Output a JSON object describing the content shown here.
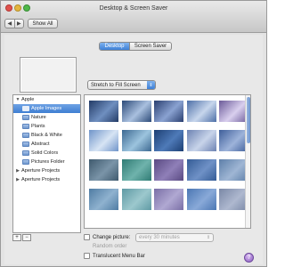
{
  "window": {
    "title": "Desktop & Screen Saver",
    "nav_back": "◀",
    "nav_forward": "▶",
    "show_all_label": "Show All"
  },
  "tabs": [
    {
      "label": "Desktop",
      "selected": true
    },
    {
      "label": "Screen Saver",
      "selected": false
    }
  ],
  "fit_select": {
    "value": "Stretch to Fill Screen",
    "chevron": "⇕"
  },
  "source_list": {
    "groups": [
      {
        "label": "Apple",
        "disclosure": "▼"
      },
      {
        "label": "Aperture Projects",
        "disclosure": "▶"
      },
      {
        "label": "Aperture Projects",
        "disclosure": "▶"
      }
    ],
    "children": [
      {
        "label": "Apple Images",
        "selected": true
      },
      {
        "label": "Nature"
      },
      {
        "label": "Plants"
      },
      {
        "label": "Black & White"
      },
      {
        "label": "Abstract"
      },
      {
        "label": "Solid Colors"
      },
      {
        "label": "Pictures Folder"
      }
    ]
  },
  "thumbnails": [
    {
      "color_a": "#233b66",
      "color_b": "#6f8fc0"
    },
    {
      "color_a": "#2c4a78",
      "color_b": "#a9c0df"
    },
    {
      "color_a": "#2a3f70",
      "color_b": "#8aa2d1"
    },
    {
      "color_a": "#4d6fa7",
      "color_b": "#c7d6ec"
    },
    {
      "color_a": "#6b5a98",
      "color_b": "#d9cfee"
    },
    {
      "color_a": "#6f94c9",
      "color_b": "#d7e4f4"
    },
    {
      "color_a": "#3c6891",
      "color_b": "#9cc4de"
    },
    {
      "color_a": "#1d3f73",
      "color_b": "#4e7ab8"
    },
    {
      "color_a": "#6c82b2",
      "color_b": "#c8d4ea"
    },
    {
      "color_a": "#3e5e9a",
      "color_b": "#9db3da"
    },
    {
      "color_a": "#3f5a6e",
      "color_b": "#7a94a8"
    },
    {
      "color_a": "#2f7b74",
      "color_b": "#6fb3ac"
    },
    {
      "color_a": "#5a4a82",
      "color_b": "#8f7fb8"
    },
    {
      "color_a": "#345c96",
      "color_b": "#6f91c6"
    },
    {
      "color_a": "#5d7fa9",
      "color_b": "#9fb6d4"
    },
    {
      "color_a": "#4f7ca3",
      "color_b": "#8fb2cf"
    },
    {
      "color_a": "#5f9aa4",
      "color_b": "#9cc8cd"
    },
    {
      "color_a": "#7a6fa6",
      "color_b": "#b0a8d2"
    },
    {
      "color_a": "#4b77b3",
      "color_b": "#89a9d8"
    },
    {
      "color_a": "#7a88a6",
      "color_b": "#aeb8cf"
    }
  ],
  "controls": {
    "add": "+",
    "remove": "−",
    "change_picture_label": "Change picture:",
    "interval_value": "every 30 minutes",
    "interval_chevron": "⇕",
    "random_order_label": "Random order",
    "translucent_menu_bar_label": "Translucent Menu Bar",
    "help_label": "?"
  },
  "colors": {
    "accent": "#3d80d7",
    "window_bg": "#e3e3e3"
  }
}
